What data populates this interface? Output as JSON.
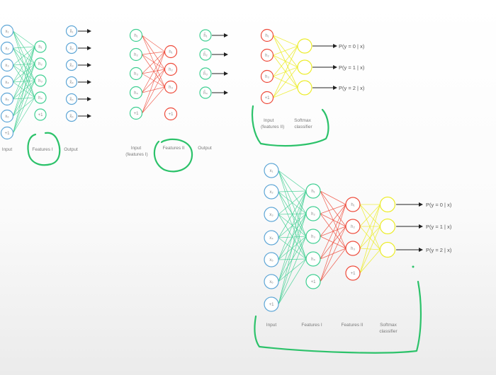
{
  "colors": {
    "blue": "#5ea6d6",
    "green": "#3fcf92",
    "red": "#ee4a3a",
    "yellow": "#ecec28",
    "annotation": "#2cc26a",
    "arrow": "#222222"
  },
  "diagrams": {
    "autoencoder1": {
      "input_nodes": [
        "x₁",
        "x₂",
        "x₃",
        "x₄",
        "x₅",
        "x₆",
        "+1"
      ],
      "hidden_nodes": [
        "h₁",
        "h₂",
        "h₃",
        "h₄",
        "+1"
      ],
      "output_nodes": [
        "x̂₁",
        "x̂₂",
        "x̂₃",
        "x̂₄",
        "x̂₅",
        "x̂₆"
      ],
      "labels": {
        "input": "Input",
        "features": "Features I",
        "output": "Output"
      }
    },
    "autoencoder2": {
      "input_nodes": [
        "h₁",
        "h₂",
        "h₃",
        "h₄",
        "+1"
      ],
      "hidden_nodes": [
        "h₁",
        "h₂",
        "h₃",
        "+1"
      ],
      "output_nodes": [
        "ĥ₁",
        "ĥ₂",
        "ĥ₃",
        "ĥ₄"
      ],
      "labels": {
        "input_line1": "Input",
        "input_line2": "(features I)",
        "features": "Features II",
        "output": "Output"
      }
    },
    "softmax": {
      "input_nodes": [
        "h₁",
        "h₂",
        "h₃",
        "+1"
      ],
      "output_nodes": [
        "",
        "",
        ""
      ],
      "probabilities": [
        "P(y = 0 | x)",
        "P(y = 1 | x)",
        "P(y = 2 | x)"
      ],
      "labels": {
        "input_line1": "Input",
        "input_line2": "(features II)",
        "classifier_line1": "Softmax",
        "classifier_line2": "classifier"
      }
    },
    "stacked": {
      "input_nodes": [
        "x₁",
        "x₂",
        "x₃",
        "x₄",
        "x₅",
        "x₆",
        "+1"
      ],
      "features1_nodes": [
        "h₁",
        "h₂",
        "h₃",
        "h₄",
        "+1"
      ],
      "features2_nodes": [
        "h₁",
        "h₂",
        "h₃",
        "+1"
      ],
      "softmax_nodes": [
        "",
        "",
        ""
      ],
      "probabilities": [
        "P(y = 0 | x)",
        "P(y = 1 | x)",
        "P(y = 2 | x)"
      ],
      "labels": {
        "input": "Input",
        "features1": "Features I",
        "features2": "Features II",
        "classifier_line1": "Softmax",
        "classifier_line2": "classifier"
      }
    }
  }
}
